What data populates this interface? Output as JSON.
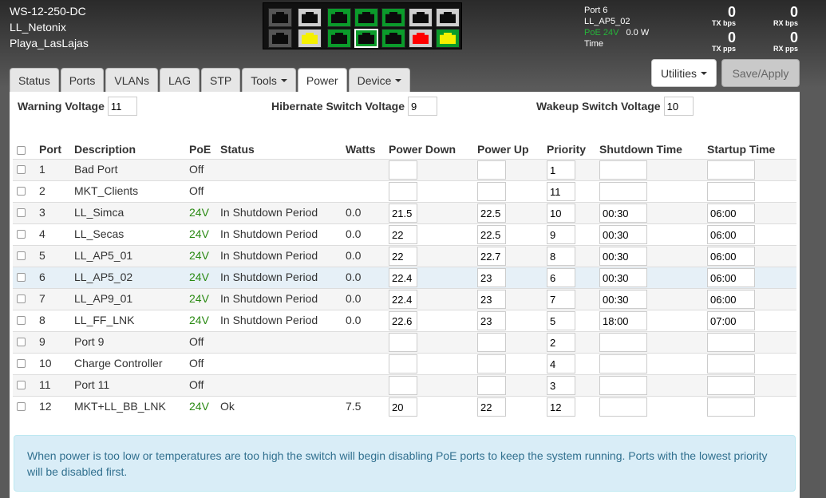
{
  "device": {
    "model": "WS-12-250-DC",
    "name": "LL_Netonix",
    "location": "Playa_LasLajas"
  },
  "port_panel": {
    "top": [
      {
        "bg": "dark",
        "jack": "black"
      },
      {
        "bg": "grey",
        "jack": "black"
      },
      {
        "bg": "green",
        "jack": "black"
      },
      {
        "bg": "green",
        "jack": "black"
      },
      {
        "bg": "green",
        "jack": "black"
      },
      {
        "bg": "grey",
        "jack": "black"
      },
      {
        "bg": "grey",
        "jack": "black"
      }
    ],
    "bottom": [
      {
        "bg": "dark",
        "jack": "black"
      },
      {
        "bg": "grey",
        "jack": "yellow"
      },
      {
        "bg": "green",
        "jack": "black"
      },
      {
        "bg": "green",
        "jack": "black",
        "selected": true
      },
      {
        "bg": "green",
        "jack": "black"
      },
      {
        "bg": "grey",
        "jack": "red"
      },
      {
        "bg": "green",
        "jack": "yellow"
      }
    ]
  },
  "status": {
    "port": "Port 6",
    "description": "LL_AP5_02",
    "poe": "PoE 24V",
    "watts": "0.0 W",
    "time_label": "Time"
  },
  "counters": {
    "tx_bps": "0",
    "tx_bps_label": "TX bps",
    "rx_bps": "0",
    "rx_bps_label": "RX bps",
    "tx_pps": "0",
    "tx_pps_label": "TX pps",
    "rx_pps": "0",
    "rx_pps_label": "RX pps"
  },
  "buttons": {
    "utilities": "Utilities",
    "save_apply": "Save/Apply"
  },
  "tabs": [
    {
      "label": "Status"
    },
    {
      "label": "Ports"
    },
    {
      "label": "VLANs"
    },
    {
      "label": "LAG"
    },
    {
      "label": "STP"
    },
    {
      "label": "Tools",
      "dropdown": true
    },
    {
      "label": "Power",
      "active": true
    },
    {
      "label": "Device",
      "dropdown": true
    }
  ],
  "voltages": {
    "warning_label": "Warning Voltage",
    "warning_value": "11",
    "hibernate_label": "Hibernate Switch Voltage",
    "hibernate_value": "9",
    "wakeup_label": "Wakeup Switch Voltage",
    "wakeup_value": "10"
  },
  "table": {
    "headers": {
      "port": "Port",
      "description": "Description",
      "poe": "PoE",
      "status": "Status",
      "watts": "Watts",
      "power_down": "Power Down",
      "power_up": "Power Up",
      "priority": "Priority",
      "shutdown": "Shutdown Time",
      "startup": "Startup Time"
    },
    "rows": [
      {
        "port": "1",
        "description": "Bad Port",
        "poe": "Off",
        "status": "",
        "watts": "",
        "power_down": "",
        "power_up": "",
        "priority": "1",
        "shutdown": "",
        "startup": ""
      },
      {
        "port": "2",
        "description": "MKT_Clients",
        "poe": "Off",
        "status": "",
        "watts": "",
        "power_down": "",
        "power_up": "",
        "priority": "11",
        "shutdown": "",
        "startup": ""
      },
      {
        "port": "3",
        "description": "LL_Simca",
        "poe": "24V",
        "status": "In Shutdown Period",
        "watts": "0.0",
        "power_down": "21.5",
        "power_up": "22.5",
        "priority": "10",
        "shutdown": "00:30",
        "startup": "06:00"
      },
      {
        "port": "4",
        "description": "LL_Secas",
        "poe": "24V",
        "status": "In Shutdown Period",
        "watts": "0.0",
        "power_down": "22",
        "power_up": "22.5",
        "priority": "9",
        "shutdown": "00:30",
        "startup": "06:00"
      },
      {
        "port": "5",
        "description": "LL_AP5_01",
        "poe": "24V",
        "status": "In Shutdown Period",
        "watts": "0.0",
        "power_down": "22",
        "power_up": "22.7",
        "priority": "8",
        "shutdown": "00:30",
        "startup": "06:00"
      },
      {
        "port": "6",
        "description": "LL_AP5_02",
        "poe": "24V",
        "status": "In Shutdown Period",
        "watts": "0.0",
        "power_down": "22.4",
        "power_up": "23",
        "priority": "6",
        "shutdown": "00:30",
        "startup": "06:00",
        "highlight": true
      },
      {
        "port": "7",
        "description": "LL_AP9_01",
        "poe": "24V",
        "status": "In Shutdown Period",
        "watts": "0.0",
        "power_down": "22.4",
        "power_up": "23",
        "priority": "7",
        "shutdown": "00:30",
        "startup": "06:00"
      },
      {
        "port": "8",
        "description": "LL_FF_LNK",
        "poe": "24V",
        "status": "In Shutdown Period",
        "watts": "0.0",
        "power_down": "22.6",
        "power_up": "23",
        "priority": "5",
        "shutdown": "18:00",
        "startup": "07:00"
      },
      {
        "port": "9",
        "description": "Port 9",
        "poe": "Off",
        "status": "",
        "watts": "",
        "power_down": "",
        "power_up": "",
        "priority": "2",
        "shutdown": "",
        "startup": ""
      },
      {
        "port": "10",
        "description": "Charge Controller",
        "poe": "Off",
        "status": "",
        "watts": "",
        "power_down": "",
        "power_up": "",
        "priority": "4",
        "shutdown": "",
        "startup": ""
      },
      {
        "port": "11",
        "description": "Port 11",
        "poe": "Off",
        "status": "",
        "watts": "",
        "power_down": "",
        "power_up": "",
        "priority": "3",
        "shutdown": "",
        "startup": ""
      },
      {
        "port": "12",
        "description": "MKT+LL_BB_LNK",
        "poe": "24V",
        "status": "Ok",
        "watts": "7.5",
        "power_down": "20",
        "power_up": "22",
        "priority": "12",
        "shutdown": "",
        "startup": ""
      }
    ]
  },
  "info": {
    "message": "When power is too low or temperatures are too high the switch will begin disabling PoE ports to keep the system running. Ports with the lowest priority will be disabled first."
  }
}
